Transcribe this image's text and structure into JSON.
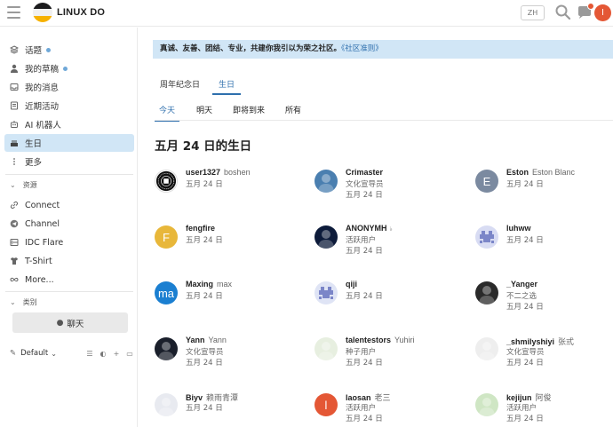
{
  "header": {
    "site_title": "LINUX DO",
    "lang": "ZH",
    "avatar_letter": "I",
    "colors": {
      "accent": "#2e6fad",
      "avatar": "#e45735"
    }
  },
  "sidebar": {
    "items": [
      {
        "label": "话题",
        "icon": "topics-icon",
        "dot": true
      },
      {
        "label": "我的草稿",
        "icon": "user-icon",
        "dot": true
      },
      {
        "label": "我的消息",
        "icon": "inbox-icon",
        "dot": false
      },
      {
        "label": "近期活动",
        "icon": "document-icon",
        "dot": false
      },
      {
        "label": "AI 机器人",
        "icon": "robot-icon",
        "dot": false
      },
      {
        "label": "生日",
        "icon": "cake-icon",
        "dot": false,
        "active": true
      },
      {
        "label": "更多",
        "icon": "more-icon",
        "dot": false
      }
    ],
    "resources_title": "资源",
    "resources": [
      {
        "label": "Connect",
        "icon": "link-icon"
      },
      {
        "label": "Channel",
        "icon": "telegram-icon"
      },
      {
        "label": "IDC Flare",
        "icon": "server-icon"
      },
      {
        "label": "T-Shirt",
        "icon": "tshirt-icon"
      },
      {
        "label": "More...",
        "icon": "infinity-icon"
      }
    ],
    "categories_title": "类别",
    "chat_label": "聊天",
    "theme_label": "Default"
  },
  "main": {
    "banner_text": "真诚、友善、团结、专业，共建你我引以为荣之社区。",
    "banner_link": "《社区准则》",
    "top_tabs": [
      "周年纪念日",
      "生日"
    ],
    "sub_tabs": [
      "今天",
      "明天",
      "即将到来",
      "所有"
    ],
    "page_title": "五月 24 日的生日",
    "users": [
      {
        "username": "user1327",
        "name": "boshen",
        "title": "",
        "date": "五月 24 日",
        "avatar_bg": "#ffffff",
        "avatar_type": "seal"
      },
      {
        "username": "Crimaster",
        "name": "",
        "title": "文化宣导员",
        "date": "五月 24 日",
        "avatar_bg": "#4a7fb0",
        "avatar_type": "photo"
      },
      {
        "username": "Eston",
        "name": "Eston Blanc",
        "title": "",
        "date": "五月 24 日",
        "avatar_bg": "#7b8aa0",
        "avatar_letter": "E"
      },
      {
        "username": "fengfire",
        "name": "",
        "title": "",
        "date": "五月 24 日",
        "avatar_bg": "#e8b73a",
        "avatar_letter": "F"
      },
      {
        "username": "ANONYMH",
        "name": "",
        "title": "活跃用户",
        "date": "五月 24 日",
        "avatar_bg": "#0d1b3a",
        "avatar_type": "photo",
        "flair": "♭"
      },
      {
        "username": "luhww",
        "name": "",
        "title": "",
        "date": "五月 24 日",
        "avatar_bg": "#d8dcf3",
        "avatar_type": "pixel"
      },
      {
        "username": "Maxing",
        "name": "max",
        "title": "",
        "date": "五月 24 日",
        "avatar_bg": "#1b7fd1",
        "avatar_letter": "ma"
      },
      {
        "username": "qiji",
        "name": "",
        "title": "",
        "date": "五月 24 日",
        "avatar_bg": "#dfe4f5",
        "avatar_type": "pixel"
      },
      {
        "username": "_Yanger",
        "name": "",
        "title": "不二之选",
        "date": "五月 24 日",
        "avatar_bg": "#2a2a2a",
        "avatar_type": "photo"
      },
      {
        "username": "Yann",
        "name": "Yann",
        "title": "文化宣导员",
        "date": "五月 24 日",
        "avatar_bg": "#1a1f2b",
        "avatar_type": "photo"
      },
      {
        "username": "talentestors",
        "name": "Yuhiri",
        "title": "种子用户",
        "date": "五月 24 日",
        "avatar_bg": "#e7efe0",
        "avatar_type": "photo"
      },
      {
        "username": "_shmilyshiyi",
        "name": "张弎",
        "title": "文化宣导员",
        "date": "五月 24 日",
        "avatar_bg": "#eeeeee",
        "avatar_type": "photo"
      },
      {
        "username": "Biyv",
        "name": "赖雨青潭",
        "title": "",
        "date": "五月 24 日",
        "avatar_bg": "#e8eaf0",
        "avatar_type": "photo"
      },
      {
        "username": "laosan",
        "name": "老三",
        "title": "活跃用户",
        "date": "五月 24 日",
        "avatar_bg": "#e45735",
        "avatar_letter": "l"
      },
      {
        "username": "kejijun",
        "name": "阿俊",
        "title": "活跃用户",
        "date": "五月 24 日",
        "avatar_bg": "#cfe6c4",
        "avatar_type": "photo"
      }
    ]
  }
}
